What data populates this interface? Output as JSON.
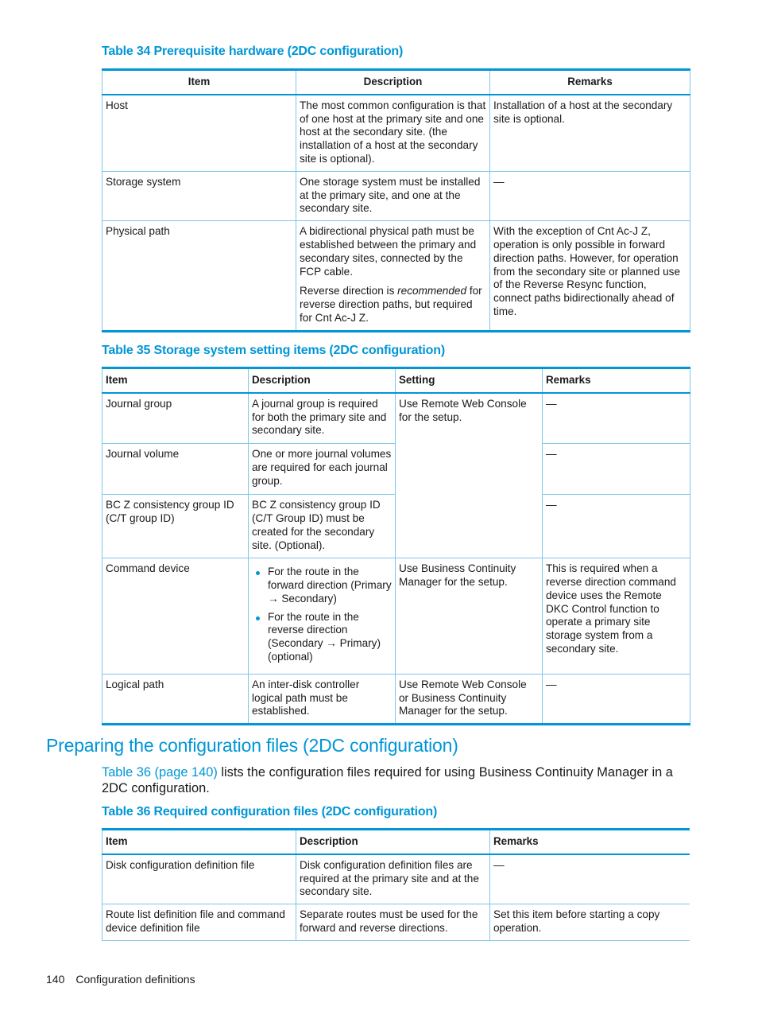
{
  "table34": {
    "caption": "Table 34 Prerequisite hardware (2DC configuration)",
    "headers": [
      "Item",
      "Description",
      "Remarks"
    ],
    "rows": [
      {
        "item": "Host",
        "description": "The most common configuration is that of one host at the primary site and one host at the secondary site. (the installation of a host at the secondary site is optional).",
        "remarks": "Installation of a host at the secondary site is optional."
      },
      {
        "item": "Storage system",
        "description": "One storage system must be installed at the primary site, and one at the secondary site.",
        "remarks": "—"
      },
      {
        "item": "Physical path",
        "description": "A bidirectional physical path must be established between the primary and secondary sites, connected by the FCP cable.",
        "description2_pre": "Reverse direction is ",
        "description2_em": "recommended",
        "description2_post": " for reverse direction paths, but required for Cnt Ac-J Z.",
        "remarks": "With the exception of Cnt Ac-J Z, operation is only possible in forward direction paths. However, for operation from the secondary site or planned use of the Reverse Resync function, connect paths bidirectionally ahead of time."
      }
    ]
  },
  "table35": {
    "caption": "Table 35 Storage system setting items (2DC configuration)",
    "headers": [
      "Item",
      "Description",
      "Setting",
      "Remarks"
    ],
    "rows": [
      {
        "item": "Journal group",
        "description": "A journal group is required for both the primary site and secondary site.",
        "setting": "Use Remote Web Console for the setup.",
        "remarks": "—"
      },
      {
        "item": "Journal volume",
        "description": "One or more journal volumes are required for each journal group.",
        "remarks": "—"
      },
      {
        "item": "BC Z consistency group ID (C/T group ID)",
        "description": "BC Z consistency group ID (C/T Group ID) must be created for the secondary site. (Optional).",
        "remarks": "—"
      },
      {
        "item": "Command device",
        "bullets": [
          "For the route in the forward direction (Primary → Secondary)",
          "For the route in the reverse direction (Secondary → Primary) (optional)"
        ],
        "setting": "Use Business Continuity Manager for the setup.",
        "remarks": "This is required when a reverse direction command device uses the Remote DKC Control function to operate a primary site storage system from a secondary site."
      },
      {
        "item": "Logical path",
        "description": "An inter-disk controller logical path must be established.",
        "setting": "Use Remote Web Console or Business Continuity Manager for the setup.",
        "remarks": "—"
      }
    ]
  },
  "section": {
    "title": "Preparing the configuration files (2DC configuration)",
    "intro_link": "Table 36 (page 140)",
    "intro_text": " lists the configuration files required for using Business Continuity Manager in a 2DC configuration."
  },
  "table36": {
    "caption": "Table 36 Required configuration files (2DC configuration)",
    "headers": [
      "Item",
      "Description",
      "Remarks"
    ],
    "rows": [
      {
        "item": "Disk configuration definition file",
        "description": "Disk configuration definition files are required at the primary site and at the secondary site.",
        "remarks": "—"
      },
      {
        "item": "Route list definition file and command device definition file",
        "description": "Separate routes must be used for the forward and reverse directions.",
        "remarks": "Set this item before starting a copy operation."
      }
    ]
  },
  "footer": {
    "page_number": "140",
    "section_name": "Configuration definitions"
  },
  "colors": {
    "accent": "#0096d6",
    "rule_light": "#7fc6ec",
    "text": "#1a1a1a"
  }
}
